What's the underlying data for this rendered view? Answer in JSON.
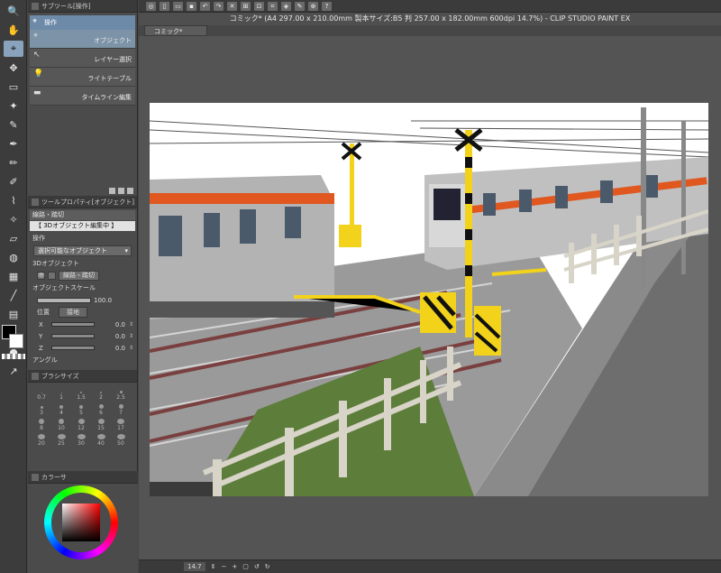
{
  "window": {
    "title": "コミック* (A4 297.00 x 210.00mm 製本サイズ:B5 判 257.00 x 182.00mm 600dpi 14.7%)  - CLIP STUDIO PAINT EX",
    "doc_tab": "コミック*"
  },
  "subtool_panel": {
    "title": "サブツール[操作]",
    "tab": "操作",
    "items": [
      {
        "label": "オブジェクト",
        "icon": "object-select-icon",
        "active": true
      },
      {
        "label": "レイヤー選択",
        "icon": "layer-select-icon",
        "active": false
      },
      {
        "label": "ライトテーブル",
        "icon": "lighttable-icon",
        "active": false
      },
      {
        "label": "タイムライン編集",
        "icon": "timeline-icon",
        "active": false
      }
    ]
  },
  "tool_property": {
    "title": "ツールプロパティ[オブジェクト]",
    "header": "線路・踏切",
    "mode_banner": "【 3Dオブジェクト編集中 】",
    "operation_label": "操作",
    "operation_value": "選択可能なオブジェクト",
    "object_section": "3Dオブジェクト",
    "object_name": "線路・踏切",
    "scale_label": "オブジェクトスケール",
    "scale_value": "100.0",
    "position_label": "位置",
    "position_button": "接地",
    "axes": [
      {
        "label": "X",
        "value": "0.0"
      },
      {
        "label": "Y",
        "value": "0.0"
      },
      {
        "label": "Z",
        "value": "0.0"
      }
    ],
    "angle_label": "アングル"
  },
  "brush_panel": {
    "title": "ブラシサイズ",
    "sizes": [
      "0.7",
      "1",
      "1.5",
      "2",
      "2.5",
      "3",
      "4",
      "5",
      "6",
      "7",
      "8",
      "10",
      "12",
      "15",
      "17",
      "20",
      "25",
      "30",
      "40",
      "50"
    ]
  },
  "color_panel": {
    "title": "カラーサ",
    "main_color": "#000000",
    "sub_color": "#ffffff"
  },
  "statusbar": {
    "zoom": "14.7"
  },
  "colors": {
    "accent": "#6d8aa8",
    "panel_bg": "#4b4b4b",
    "train_stripe": "#e0571f"
  }
}
